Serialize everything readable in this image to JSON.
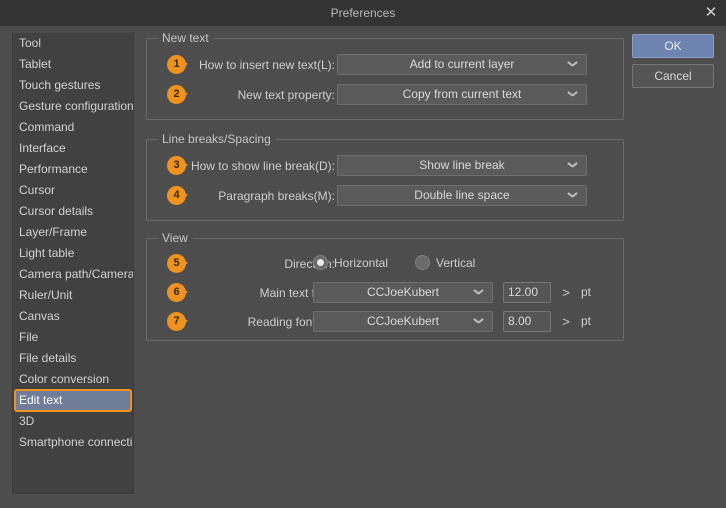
{
  "window": {
    "title": "Preferences",
    "close_icon": "close-icon"
  },
  "colors": {
    "accent_orange": "#f0921f",
    "selection_blue": "#6f7d9b",
    "ok_button_blue": "#6f83b0",
    "dialog_bg": "#4d4d4d",
    "titlebar_bg": "#333333",
    "list_bg": "#414141"
  },
  "sidebar": {
    "items": [
      {
        "label": "Tool",
        "selected": false
      },
      {
        "label": "Tablet",
        "selected": false
      },
      {
        "label": "Touch gestures",
        "selected": false
      },
      {
        "label": "Gesture configuration",
        "selected": false
      },
      {
        "label": "Command",
        "selected": false
      },
      {
        "label": "Interface",
        "selected": false
      },
      {
        "label": "Performance",
        "selected": false
      },
      {
        "label": "Cursor",
        "selected": false
      },
      {
        "label": "Cursor details",
        "selected": false
      },
      {
        "label": "Layer/Frame",
        "selected": false
      },
      {
        "label": "Light table",
        "selected": false
      },
      {
        "label": "Camera path/Camera",
        "selected": false
      },
      {
        "label": "Ruler/Unit",
        "selected": false
      },
      {
        "label": "Canvas",
        "selected": false
      },
      {
        "label": "File",
        "selected": false
      },
      {
        "label": "File details",
        "selected": false
      },
      {
        "label": "Color conversion",
        "selected": false
      },
      {
        "label": "Edit text",
        "selected": true
      },
      {
        "label": "3D",
        "selected": false
      },
      {
        "label": "Smartphone connection",
        "selected": false
      }
    ]
  },
  "buttons": {
    "ok": "OK",
    "cancel": "Cancel"
  },
  "groups": {
    "new_text": {
      "title": "New text",
      "rows": [
        {
          "badge": "1",
          "label": "How to insert new text(L):",
          "value": "Add to current layer"
        },
        {
          "badge": "2",
          "label": "New text property:",
          "value": "Copy from current text"
        }
      ]
    },
    "line_breaks": {
      "title": "Line breaks/Spacing",
      "rows": [
        {
          "badge": "3",
          "label": "How to show line break(D):",
          "value": "Show line break"
        },
        {
          "badge": "4",
          "label": "Paragraph breaks(M):",
          "value": "Double line space"
        }
      ]
    },
    "view": {
      "title": "View",
      "direction": {
        "badge": "5",
        "label": "Direction:",
        "options": [
          {
            "label": "Horizontal",
            "checked": true
          },
          {
            "label": "Vertical",
            "checked": false
          }
        ]
      },
      "fonts": [
        {
          "badge": "6",
          "label": "Main text font:",
          "font": "CCJoeKubert",
          "size": "12.00",
          "stepper": ">",
          "unit": "pt"
        },
        {
          "badge": "7",
          "label": "Reading font(B):",
          "font": "CCJoeKubert",
          "size": "8.00",
          "stepper": ">",
          "unit": "pt"
        }
      ]
    }
  }
}
